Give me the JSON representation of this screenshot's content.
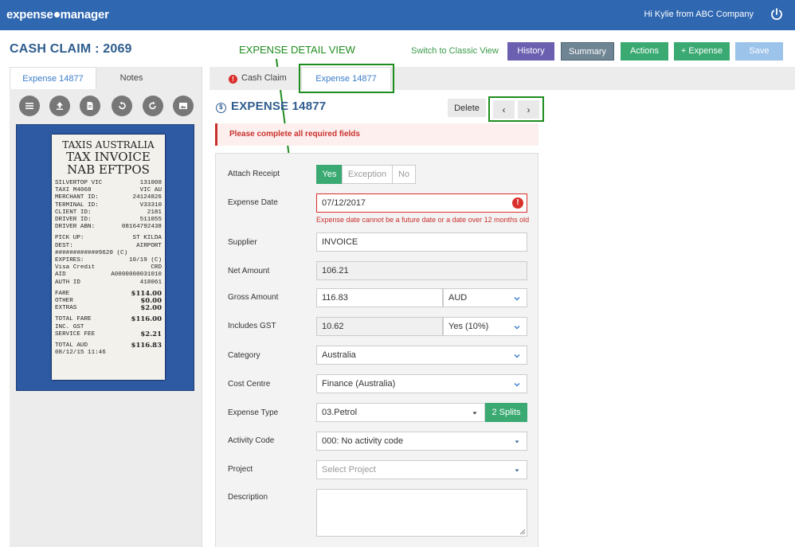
{
  "topbar": {
    "logo_left": "expense",
    "logo_right": "manager",
    "greeting": "Hi Kylie from ABC Company",
    "power_icon": "power-icon"
  },
  "claim": {
    "title": "CASH CLAIM : 2069"
  },
  "annotation": {
    "text": "EXPENSE DETAIL VIEW",
    "color": "#1f8c1f"
  },
  "toolbar": {
    "switch_link": "Switch to Classic View",
    "history": "History",
    "summary": "Summary",
    "actions": "Actions",
    "expense": "+ Expense",
    "save": "Save"
  },
  "left_tabs": {
    "expense": "Expense 14877",
    "notes": "Notes"
  },
  "receipt_tools": [
    "list-icon",
    "upload-icon",
    "document-icon",
    "rotate-left-icon",
    "rotate-right-icon",
    "image-icon"
  ],
  "receipt": {
    "head1": "TAXIS AUSTRALIA",
    "head2": "TAX INVOICE",
    "head3": "NAB EFTPOS",
    "lines": [
      [
        "SILVERTOP VIC",
        "131008"
      ],
      [
        "TAXI M4068",
        "VIC AU"
      ],
      [
        "MERCHANT ID:",
        "24124826"
      ],
      [
        "TERMINAL ID:",
        "V33310"
      ],
      [
        "CLIENT ID:",
        "2181"
      ],
      [
        "DRIVER ID:",
        "511055"
      ],
      [
        "DRIVER ABN:",
        "08164792438"
      ]
    ],
    "lines2": [
      [
        "PICK UP:",
        "ST KILDA"
      ],
      [
        "DEST:",
        "AIRPORT"
      ],
      [
        "############9620 (C)",
        ""
      ],
      [
        "EXPIRES:",
        "10/19 (C)"
      ],
      [
        "Visa Credit",
        "CRD"
      ],
      [
        "AID",
        "A0000000031010"
      ],
      [
        "AUTH ID",
        "418061"
      ]
    ],
    "lines3": [
      [
        "FARE",
        "$114.00"
      ],
      [
        "OTHER",
        "$0.00"
      ],
      [
        "EXTRAS",
        "$2.00"
      ]
    ],
    "lines4": [
      [
        "TOTAL FARE",
        "$116.00"
      ],
      [
        "INC. GST",
        ""
      ],
      [
        "SERVICE FEE",
        "$2.21"
      ]
    ],
    "lines5": [
      [
        "TOTAL      AUD",
        "$116.83"
      ],
      [
        "08/12/15  11:46",
        ""
      ]
    ]
  },
  "main_tabs": {
    "cash_claim": "Cash Claim",
    "expense": "Expense 14877"
  },
  "expense": {
    "title": "EXPENSE 14877",
    "delete": "Delete",
    "prev": "‹",
    "next": "›"
  },
  "alert": {
    "text": "Please complete all required fields"
  },
  "form": {
    "attach_receipt": {
      "label": "Attach Receipt",
      "options": [
        "Yes",
        "Exception",
        "No"
      ],
      "selected": "Yes"
    },
    "expense_date": {
      "label": "Expense Date",
      "value": "07/12/2017",
      "error": "Expense date cannot be a future date or a date over 12 months old"
    },
    "supplier": {
      "label": "Supplier",
      "value": "INVOICE"
    },
    "net_amount": {
      "label": "Net Amount",
      "value": "106.21"
    },
    "gross_amount": {
      "label": "Gross Amount",
      "value": "116.83",
      "currency": "AUD"
    },
    "includes_gst": {
      "label": "Includes GST",
      "value": "10.62",
      "rate": "Yes (10%)"
    },
    "category": {
      "label": "Category",
      "value": "Australia"
    },
    "cost_centre": {
      "label": "Cost Centre",
      "value": "Finance (Australia)"
    },
    "expense_type": {
      "label": "Expense Type",
      "value": "03.Petrol",
      "splits": "2 Splits"
    },
    "activity_code": {
      "label": "Activity Code",
      "value": "000: No activity code"
    },
    "project": {
      "label": "Project",
      "placeholder": "Select Project"
    },
    "description": {
      "label": "Description",
      "value": ""
    }
  }
}
